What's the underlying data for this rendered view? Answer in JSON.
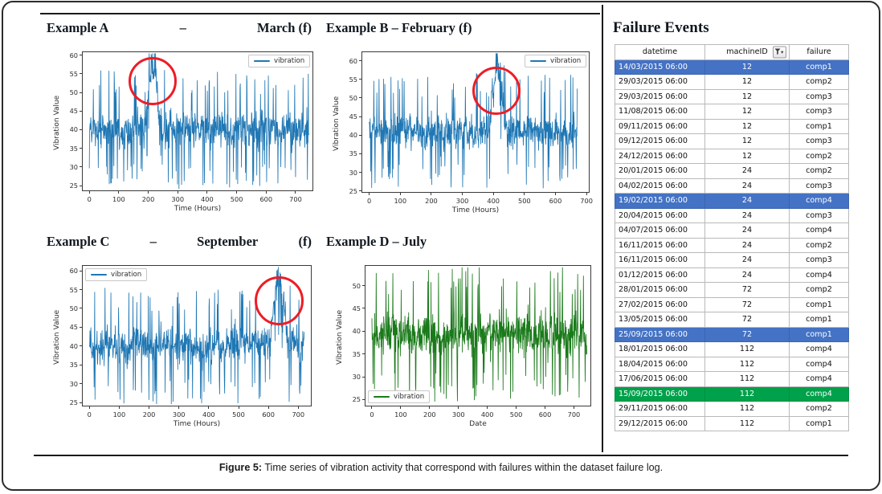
{
  "figure": {
    "caption_label": "Figure 5:",
    "caption_text": " Time series of vibration activity that correspond with failures within the dataset failure log."
  },
  "colors": {
    "series_blue": "#1f77b4",
    "series_green": "#1a7a1a",
    "highlight_circle_red": "#ee1c25",
    "row_highlight_blue": "#4472C4",
    "row_highlight_green": "#00A14B"
  },
  "panels": [
    {
      "id": "example-a",
      "title_parts": [
        "Example A",
        "–",
        "March (f)"
      ],
      "title_justified": true,
      "legend_label": "vibration",
      "legend_position": "upper-right",
      "highlight": true
    },
    {
      "id": "example-b",
      "title_parts": [
        "Example B – February (f)"
      ],
      "title_justified": false,
      "legend_label": "vibration",
      "legend_position": "upper-right",
      "highlight": true
    },
    {
      "id": "example-c",
      "title_parts": [
        "Example C",
        "–",
        "September",
        "(f)"
      ],
      "title_justified": true,
      "legend_label": "vibration",
      "legend_position": "upper-left",
      "highlight": true
    },
    {
      "id": "example-d",
      "title_parts": [
        "Example D – July"
      ],
      "title_justified": false,
      "legend_label": "vibration",
      "legend_position": "lower-left",
      "highlight": false
    }
  ],
  "chart_data": [
    {
      "id": "example-a",
      "type": "line",
      "title": "Example A – March (f)",
      "xlabel": "Time (Hours)",
      "ylabel": "Vibration Value",
      "xticks": [
        0,
        100,
        200,
        300,
        400,
        500,
        600,
        700
      ],
      "yticks": [
        25,
        30,
        35,
        40,
        45,
        50,
        55,
        60
      ],
      "xlim": [
        -25,
        760
      ],
      "ylim": [
        23.5,
        61
      ],
      "series_name": "vibration",
      "color": "#1f77b4",
      "grid": false,
      "legend": "upper right",
      "annotation": {
        "shape": "circle",
        "color": "#ee1c25",
        "center_x": 215,
        "center_y": 53,
        "radius_x": 55,
        "radius_y": 6.5,
        "note": "anomalous vibration burst preceding failure"
      },
      "baseline_mean": 40,
      "baseline_spread": [
        25,
        52
      ],
      "anomaly_window_x": [
        190,
        240
      ],
      "anomaly_peak_y": 60
    },
    {
      "id": "example-b",
      "type": "line",
      "title": "Example B – February (f)",
      "xlabel": "Time (Hours)",
      "ylabel": "Vibration Value",
      "xticks": [
        0,
        100,
        200,
        300,
        400,
        500,
        600,
        700
      ],
      "yticks": [
        25,
        30,
        35,
        40,
        45,
        50,
        55,
        60
      ],
      "xlim": [
        -25,
        710
      ],
      "ylim": [
        24.5,
        62.5
      ],
      "series_name": "vibration",
      "color": "#1f77b4",
      "grid": false,
      "legend": "upper right",
      "annotation": {
        "shape": "circle",
        "color": "#ee1c25",
        "center_x": 410,
        "center_y": 52,
        "radius_x": 52,
        "radius_y": 6.5,
        "note": "anomalous vibration burst preceding failure"
      },
      "baseline_mean": 41,
      "baseline_spread": [
        27,
        53
      ],
      "anomaly_window_x": [
        385,
        440
      ],
      "anomaly_peak_y": 61.5
    },
    {
      "id": "example-c",
      "type": "line",
      "title": "Example C – September (f)",
      "xlabel": "Time (Hours)",
      "ylabel": "Vibration Value",
      "xticks": [
        0,
        100,
        200,
        300,
        400,
        500,
        600,
        700
      ],
      "yticks": [
        25,
        30,
        35,
        40,
        45,
        50,
        55,
        60
      ],
      "xlim": [
        -25,
        745
      ],
      "ylim": [
        24,
        61.5
      ],
      "series_name": "vibration",
      "color": "#1f77b4",
      "grid": false,
      "legend": "upper left",
      "annotation": {
        "shape": "circle",
        "color": "#ee1c25",
        "center_x": 635,
        "center_y": 52,
        "radius_x": 55,
        "radius_y": 6.5,
        "note": "anomalous vibration burst preceding failure"
      },
      "baseline_mean": 40,
      "baseline_spread": [
        27,
        53
      ],
      "anomaly_window_x": [
        605,
        665
      ],
      "anomaly_peak_y": 61
    },
    {
      "id": "example-d",
      "type": "line",
      "title": "Example D – July",
      "xlabel": "Date",
      "ylabel": "Vibration Value",
      "xticks": [
        0,
        100,
        200,
        300,
        400,
        500,
        600,
        700
      ],
      "yticks": [
        25,
        30,
        35,
        40,
        45,
        50
      ],
      "xlim": [
        -25,
        760
      ],
      "ylim": [
        23.5,
        54.5
      ],
      "series_name": "vibration",
      "color": "#1a7a1a",
      "grid": false,
      "legend": "lower left",
      "annotation": null,
      "baseline_mean": 39.5,
      "baseline_spread": [
        25,
        50
      ],
      "anomaly_window_x": null,
      "anomaly_peak_y": null
    }
  ],
  "failure_events": {
    "heading": "Failure Events",
    "filter_icon": "filter-funnel-icon",
    "columns": [
      "datetime",
      "machineID",
      "failure"
    ],
    "rows": [
      {
        "datetime": "14/03/2015 06:00",
        "machineID": "12",
        "failure": "comp1",
        "highlight": "blue"
      },
      {
        "datetime": "29/03/2015 06:00",
        "machineID": "12",
        "failure": "comp2",
        "highlight": ""
      },
      {
        "datetime": "29/03/2015 06:00",
        "machineID": "12",
        "failure": "comp3",
        "highlight": ""
      },
      {
        "datetime": "11/08/2015 06:00",
        "machineID": "12",
        "failure": "comp3",
        "highlight": ""
      },
      {
        "datetime": "09/11/2015 06:00",
        "machineID": "12",
        "failure": "comp1",
        "highlight": ""
      },
      {
        "datetime": "09/12/2015 06:00",
        "machineID": "12",
        "failure": "comp3",
        "highlight": ""
      },
      {
        "datetime": "24/12/2015 06:00",
        "machineID": "12",
        "failure": "comp2",
        "highlight": ""
      },
      {
        "datetime": "20/01/2015 06:00",
        "machineID": "24",
        "failure": "comp2",
        "highlight": ""
      },
      {
        "datetime": "04/02/2015 06:00",
        "machineID": "24",
        "failure": "comp3",
        "highlight": ""
      },
      {
        "datetime": "19/02/2015 06:00",
        "machineID": "24",
        "failure": "comp4",
        "highlight": "blue"
      },
      {
        "datetime": "20/04/2015 06:00",
        "machineID": "24",
        "failure": "comp3",
        "highlight": ""
      },
      {
        "datetime": "04/07/2015 06:00",
        "machineID": "24",
        "failure": "comp4",
        "highlight": ""
      },
      {
        "datetime": "16/11/2015 06:00",
        "machineID": "24",
        "failure": "comp2",
        "highlight": ""
      },
      {
        "datetime": "16/11/2015 06:00",
        "machineID": "24",
        "failure": "comp3",
        "highlight": ""
      },
      {
        "datetime": "01/12/2015 06:00",
        "machineID": "24",
        "failure": "comp4",
        "highlight": ""
      },
      {
        "datetime": "28/01/2015 06:00",
        "machineID": "72",
        "failure": "comp2",
        "highlight": ""
      },
      {
        "datetime": "27/02/2015 06:00",
        "machineID": "72",
        "failure": "comp1",
        "highlight": ""
      },
      {
        "datetime": "13/05/2015 06:00",
        "machineID": "72",
        "failure": "comp1",
        "highlight": ""
      },
      {
        "datetime": "25/09/2015 06:00",
        "machineID": "72",
        "failure": "comp1",
        "highlight": "blue"
      },
      {
        "datetime": "18/01/2015 06:00",
        "machineID": "112",
        "failure": "comp4",
        "highlight": ""
      },
      {
        "datetime": "18/04/2015 06:00",
        "machineID": "112",
        "failure": "comp4",
        "highlight": ""
      },
      {
        "datetime": "17/06/2015 06:00",
        "machineID": "112",
        "failure": "comp4",
        "highlight": ""
      },
      {
        "datetime": "15/09/2015 06:00",
        "machineID": "112",
        "failure": "comp4",
        "highlight": "green"
      },
      {
        "datetime": "29/11/2015 06:00",
        "machineID": "112",
        "failure": "comp2",
        "highlight": ""
      },
      {
        "datetime": "29/12/2015 06:00",
        "machineID": "112",
        "failure": "comp1",
        "highlight": ""
      }
    ]
  }
}
